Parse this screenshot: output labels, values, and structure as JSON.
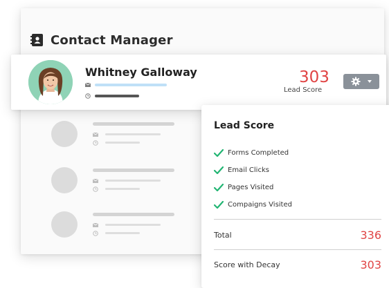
{
  "header": {
    "title": "Contact Manager",
    "icon": "contact-book-icon"
  },
  "featured_contact": {
    "name": "Whitney Galloway",
    "lead_score": "303",
    "lead_score_label": "Lead Score",
    "email_icon": "email-icon",
    "clock_icon": "clock-icon",
    "settings_icon": "gear-icon",
    "dropdown_icon": "caret-down-icon"
  },
  "lead_score_panel": {
    "title": "Lead Score",
    "criteria": [
      {
        "label": "Forms Completed",
        "icon": "checkmark-icon"
      },
      {
        "label": "Email Clicks",
        "icon": "checkmark-icon"
      },
      {
        "label": "Pages Visited",
        "icon": "checkmark-icon"
      },
      {
        "label": "Compaigns Visited",
        "icon": "checkmark-icon"
      }
    ],
    "total_label": "Total",
    "total_value": "336",
    "decay_label": "Score with Decay",
    "decay_value": "303"
  },
  "colors": {
    "score_red": "#e04444",
    "check_green": "#22b573",
    "email_bar_blue": "#bfe0f7",
    "button_gray": "#8a9199"
  }
}
